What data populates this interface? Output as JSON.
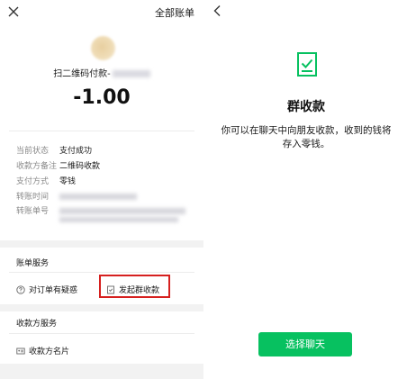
{
  "left": {
    "header": {
      "close_icon": "close-icon",
      "all_bills": "全部账单"
    },
    "merchant": {
      "name": "扫二维码付款-",
      "amount": "-1.00"
    },
    "details": [
      {
        "label": "当前状态",
        "value": "支付成功"
      },
      {
        "label": "收款方备注",
        "value": "二维码收款"
      },
      {
        "label": "支付方式",
        "value": "零钱"
      },
      {
        "label": "转账时间",
        "value": ""
      },
      {
        "label": "转账单号",
        "value": ""
      }
    ],
    "bill_service": {
      "title": "账单服务",
      "question_label": "对订单有疑惑",
      "group_collect_label": "发起群收款"
    },
    "payee_service": {
      "title": "收款方服务",
      "card_label": "收款方名片"
    }
  },
  "right": {
    "back_icon": "back-icon",
    "title": "群收款",
    "description": "你可以在聊天中向朋友收款，收到的钱将存入零钱。",
    "select_chat_label": "选择聊天",
    "accent": "#07c160"
  },
  "highlight_color": "#d6201f"
}
